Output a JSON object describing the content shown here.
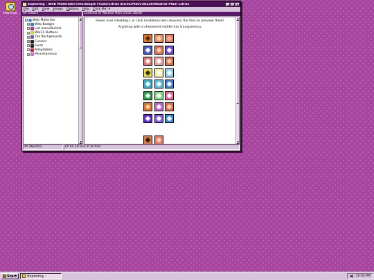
{
  "desktop": {
    "icon_label": "Materials"
  },
  "window": {
    "title": "Exploring - Web Materials/Tiles/Single Fruits/Citrus Slices/Plain/38x38/Neutral Plain Citrus",
    "menu": [
      "File",
      "Edit",
      "View",
      "Image",
      "Options",
      "Help",
      "Click Me! ▾"
    ],
    "left_header": "All Folders",
    "right_header": "Contents of 'Neutral Plain Citrus 38x38'"
  },
  "tree": {
    "root": "Web Materials",
    "items": [
      {
        "label": "Web Badges",
        "icon": "badge-icon",
        "color": "#3a7ab8"
      },
      {
        "label": "List Icons/Bullets",
        "icon": "bullet-icon",
        "color": "#b0308a"
      },
      {
        "label": "88x31 Buttons",
        "icon": "button-icon",
        "color": "#d8cf48"
      },
      {
        "label": "Tile Backgrounds",
        "icon": "tile-icon",
        "color": "#6d5cb0"
      },
      {
        "label": "Cursors",
        "icon": "cursor-icon",
        "color": "#222222"
      },
      {
        "label": "Fonts",
        "icon": "font-icon",
        "color": "#222222"
      },
      {
        "label": "Adoptables",
        "icon": "heart-icon",
        "color": "#d0203a"
      },
      {
        "label": "Miscellaneous",
        "icon": "misc-icon",
        "color": "#c36fd4"
      }
    ]
  },
  "content": {
    "hover_text": "Hover over (desktop), or click (mobile/screen devices) the tiles to preview them!",
    "transparency_text": "Anything with a checkered middle has transparency.",
    "tile_rows": [
      {
        "colors": [
          [
            "#e07a2e",
            "#5a2a10"
          ],
          [
            "#f08a5a",
            "#ffd2b0"
          ],
          [
            "#e08060",
            "#ffb0a0"
          ]
        ]
      },
      {
        "colors": [
          [
            "#4a55c8",
            "#ffffff"
          ],
          [
            "#e0704a",
            "#ffd2b8"
          ],
          [
            "#6a4ad0",
            "#ffffff"
          ]
        ]
      },
      {
        "colors": [
          [
            "#e87070",
            "#ffffff"
          ],
          [
            "#f4a0a0",
            "#ffffff"
          ],
          [
            "#d8704c",
            "#ffd0b8"
          ]
        ]
      },
      {
        "colors": [
          [
            "#f0e040",
            "#2a2a2a"
          ],
          [
            "#f6f09a",
            "#ffffff"
          ],
          [
            "#8ad0f0",
            "#ffffff"
          ]
        ]
      },
      {
        "colors": [
          [
            "#30b0c8",
            "#ffffff"
          ],
          [
            "#50c0e0",
            "#ffffff"
          ],
          [
            "#3a80d0",
            "#ffffff"
          ]
        ]
      },
      {
        "colors": [
          [
            "#20a040",
            "#ffffff"
          ],
          [
            "#7ae07a",
            "#ffffff"
          ],
          [
            "#e06898",
            "#ffffff"
          ]
        ]
      },
      {
        "colors": [
          [
            "#e0702a",
            "#ffd0a0"
          ],
          [
            "#c060d0",
            "#ffffff"
          ],
          [
            "#e07050",
            "#ffd0b0"
          ]
        ]
      },
      {
        "colors": [
          [
            "#5a2ad0",
            "#ffffff"
          ],
          [
            "#7a5ae0",
            "#ffffff"
          ],
          [
            "#3a8ad8",
            "#ffffff"
          ]
        ]
      },
      {
        "colors": [
          [
            "#e08040",
            "#2a1a0a"
          ],
          [
            "#e87860",
            "#ffd0c0"
          ]
        ]
      }
    ]
  },
  "status": {
    "objects": "40 object(s)",
    "info": "(# 81.2)P link of all tiles"
  },
  "taskbar": {
    "start": "Start",
    "task": "Exploring...",
    "clock": "10:03 PM"
  }
}
